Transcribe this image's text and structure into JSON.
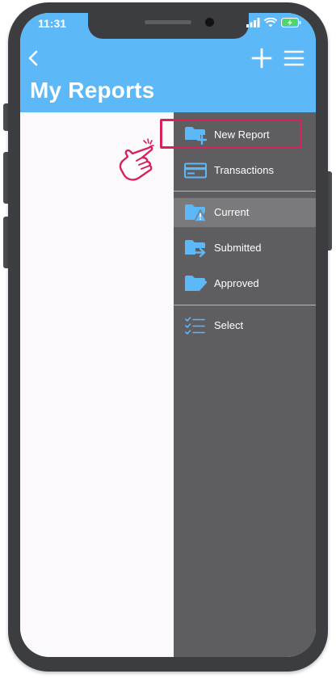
{
  "status_bar": {
    "time": "11:31"
  },
  "header": {
    "title": "My Reports",
    "back_icon": "chevron-left-icon",
    "add_icon": "plus-icon",
    "menu_icon": "hamburger-menu-icon"
  },
  "drawer": {
    "items": [
      {
        "label": "New Report",
        "icon": "folder-plus-icon"
      },
      {
        "label": "Transactions",
        "icon": "credit-card-icon"
      },
      {
        "label": "Current",
        "icon": "folder-warning-icon"
      },
      {
        "label": "Submitted",
        "icon": "folder-arrow-icon"
      },
      {
        "label": "Approved",
        "icon": "folder-check-icon"
      },
      {
        "label": "Select",
        "icon": "checklist-icon"
      }
    ],
    "selected": "Current"
  },
  "colors": {
    "header": "#5cb8f7",
    "drawer": "#5e5e60",
    "selected_item": "#7a7a7c",
    "icon_blue": "#5cb8f7",
    "highlight": "#d8225c"
  }
}
